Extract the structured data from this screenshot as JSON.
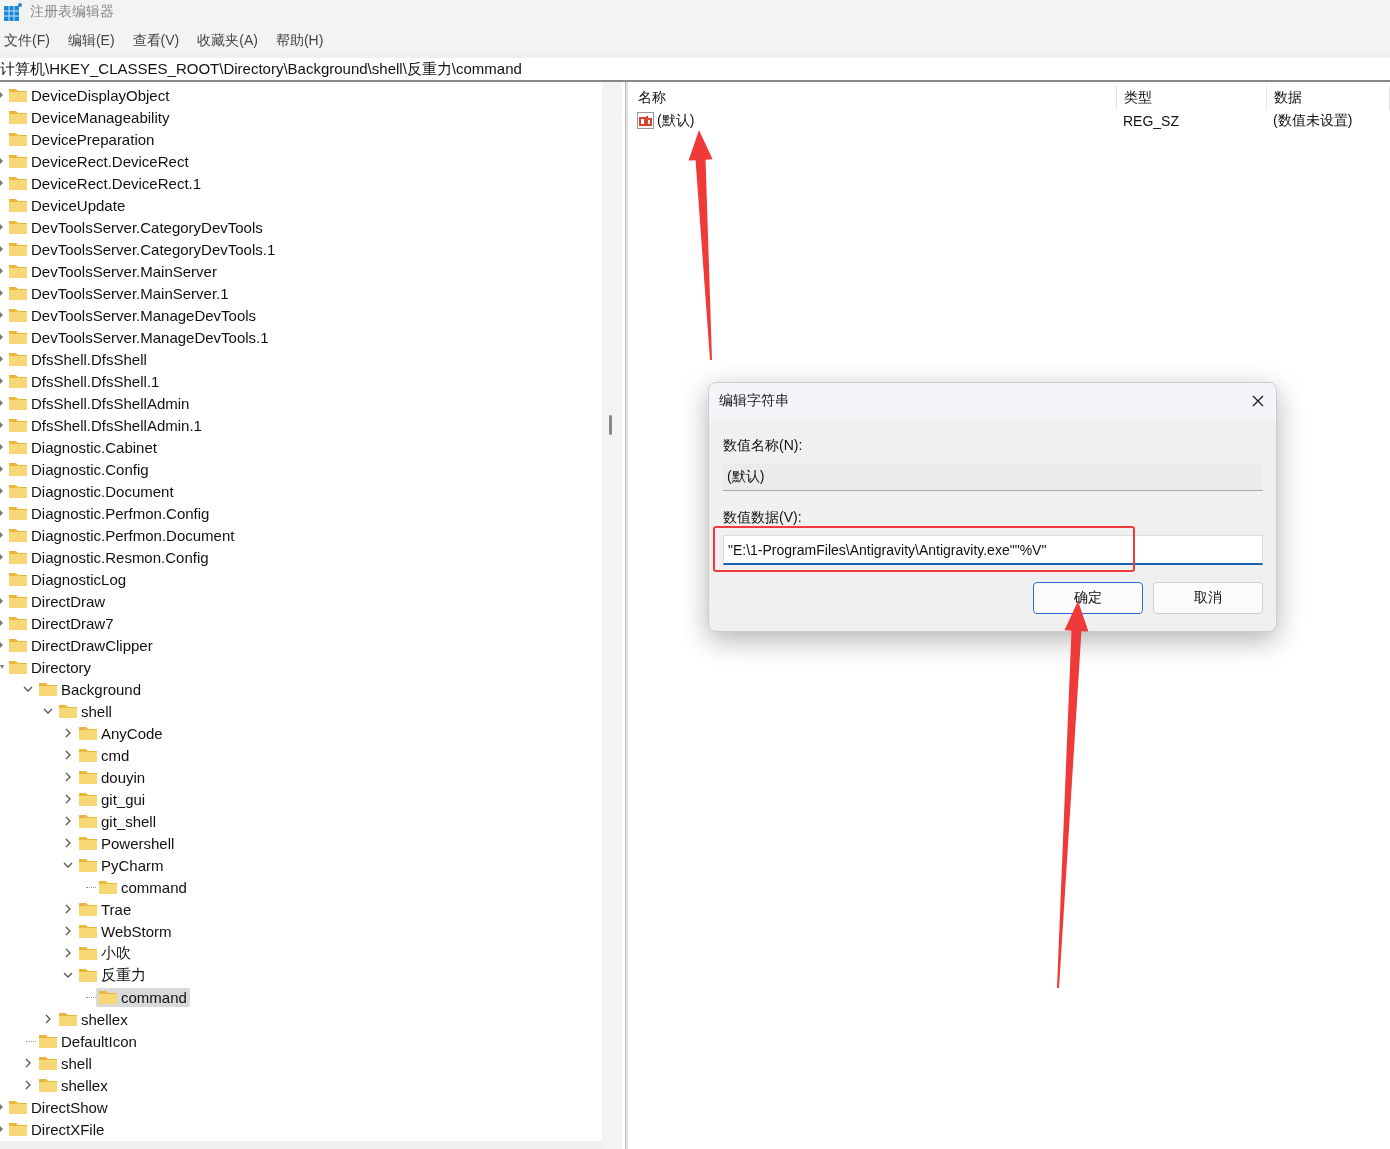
{
  "window": {
    "title": "注册表编辑器"
  },
  "menu": [
    "文件(F)",
    "编辑(E)",
    "查看(V)",
    "收藏夹(A)",
    "帮助(H)"
  ],
  "address": "计算机\\HKEY_CLASSES_ROOT\\Directory\\Background\\shell\\反重力\\command",
  "tree": [
    {
      "label": "DeviceDisplayObject",
      "kind": "node",
      "expanded": false,
      "selected": false
    },
    {
      "label": "DeviceManageability",
      "kind": "leaf",
      "selected": false
    },
    {
      "label": "DevicePreparation",
      "kind": "leaf",
      "selected": false
    },
    {
      "label": "DeviceRect.DeviceRect",
      "kind": "node",
      "expanded": false,
      "selected": false
    },
    {
      "label": "DeviceRect.DeviceRect.1",
      "kind": "node",
      "expanded": false,
      "selected": false
    },
    {
      "label": "DeviceUpdate",
      "kind": "leaf",
      "selected": false
    },
    {
      "label": "DevToolsServer.CategoryDevTools",
      "kind": "node",
      "expanded": false,
      "selected": false
    },
    {
      "label": "DevToolsServer.CategoryDevTools.1",
      "kind": "node",
      "expanded": false,
      "selected": false
    },
    {
      "label": "DevToolsServer.MainServer",
      "kind": "node",
      "expanded": false,
      "selected": false
    },
    {
      "label": "DevToolsServer.MainServer.1",
      "kind": "node",
      "expanded": false,
      "selected": false
    },
    {
      "label": "DevToolsServer.ManageDevTools",
      "kind": "node",
      "expanded": false,
      "selected": false
    },
    {
      "label": "DevToolsServer.ManageDevTools.1",
      "kind": "node",
      "expanded": false,
      "selected": false
    },
    {
      "label": "DfsShell.DfsShell",
      "kind": "node",
      "expanded": false,
      "selected": false
    },
    {
      "label": "DfsShell.DfsShell.1",
      "kind": "node",
      "expanded": false,
      "selected": false
    },
    {
      "label": "DfsShell.DfsShellAdmin",
      "kind": "node",
      "expanded": false,
      "selected": false
    },
    {
      "label": "DfsShell.DfsShellAdmin.1",
      "kind": "node",
      "expanded": false,
      "selected": false
    },
    {
      "label": "Diagnostic.Cabinet",
      "kind": "node",
      "expanded": false,
      "selected": false
    },
    {
      "label": "Diagnostic.Config",
      "kind": "node",
      "expanded": false,
      "selected": false
    },
    {
      "label": "Diagnostic.Document",
      "kind": "node",
      "expanded": false,
      "selected": false
    },
    {
      "label": "Diagnostic.Perfmon.Config",
      "kind": "node",
      "expanded": false,
      "selected": false
    },
    {
      "label": "Diagnostic.Perfmon.Document",
      "kind": "node",
      "expanded": false,
      "selected": false
    },
    {
      "label": "Diagnostic.Resmon.Config",
      "kind": "node",
      "expanded": false,
      "selected": false
    },
    {
      "label": "DiagnosticLog",
      "kind": "leaf",
      "selected": false
    },
    {
      "label": "DirectDraw",
      "kind": "node",
      "expanded": false,
      "selected": false
    },
    {
      "label": "DirectDraw7",
      "kind": "node",
      "expanded": false,
      "selected": false
    },
    {
      "label": "DirectDrawClipper",
      "kind": "node",
      "expanded": false,
      "selected": false
    },
    {
      "label": "Directory",
      "kind": "node",
      "expanded": true,
      "selected": false,
      "children": [
        {
          "label": "Background",
          "kind": "node",
          "expanded": true,
          "selected": false,
          "children": [
            {
              "label": "shell",
              "kind": "node",
              "expanded": true,
              "selected": false,
              "children": [
                {
                  "label": "AnyCode",
                  "kind": "node",
                  "expanded": false,
                  "selected": false
                },
                {
                  "label": "cmd",
                  "kind": "node",
                  "expanded": false,
                  "selected": false
                },
                {
                  "label": "douyin",
                  "kind": "node",
                  "expanded": false,
                  "selected": false
                },
                {
                  "label": "git_gui",
                  "kind": "node",
                  "expanded": false,
                  "selected": false
                },
                {
                  "label": "git_shell",
                  "kind": "node",
                  "expanded": false,
                  "selected": false
                },
                {
                  "label": "Powershell",
                  "kind": "node",
                  "expanded": false,
                  "selected": false
                },
                {
                  "label": "PyCharm",
                  "kind": "node",
                  "expanded": true,
                  "selected": false,
                  "children": [
                    {
                      "label": "command",
                      "kind": "leaf",
                      "selected": false
                    }
                  ]
                },
                {
                  "label": "Trae",
                  "kind": "node",
                  "expanded": false,
                  "selected": false
                },
                {
                  "label": "WebStorm",
                  "kind": "node",
                  "expanded": false,
                  "selected": false
                },
                {
                  "label": "小吹",
                  "kind": "node",
                  "expanded": false,
                  "selected": false
                },
                {
                  "label": "反重力",
                  "kind": "node",
                  "expanded": true,
                  "selected": false,
                  "children": [
                    {
                      "label": "command",
                      "kind": "leaf",
                      "selected": true
                    }
                  ]
                }
              ]
            },
            {
              "label": "shellex",
              "kind": "node",
              "expanded": false,
              "selected": false
            }
          ]
        },
        {
          "label": "DefaultIcon",
          "kind": "leaf",
          "selected": false
        },
        {
          "label": "shell",
          "kind": "node",
          "expanded": false,
          "selected": false
        },
        {
          "label": "shellex",
          "kind": "node",
          "expanded": false,
          "selected": false
        }
      ]
    },
    {
      "label": "DirectShow",
      "kind": "node",
      "expanded": false,
      "selected": false
    },
    {
      "label": "DirectXFile",
      "kind": "node",
      "expanded": false,
      "selected": false
    }
  ],
  "values_table": {
    "columns": [
      "名称",
      "类型",
      "数据"
    ],
    "rows": [
      {
        "name": "(默认)",
        "type": "REG_SZ",
        "data": "(数值未设置)"
      }
    ]
  },
  "dialog": {
    "title": "编辑字符串",
    "name_label": "数值名称(N):",
    "name_value": "(默认)",
    "data_label": "数值数据(V):",
    "data_value": "\"E:\\1-ProgramFiles\\Antigravity\\Antigravity.exe\"\"%V\"",
    "buttons": [
      {
        "label": "确定",
        "default": true
      },
      {
        "label": "取消",
        "default": false
      }
    ]
  }
}
